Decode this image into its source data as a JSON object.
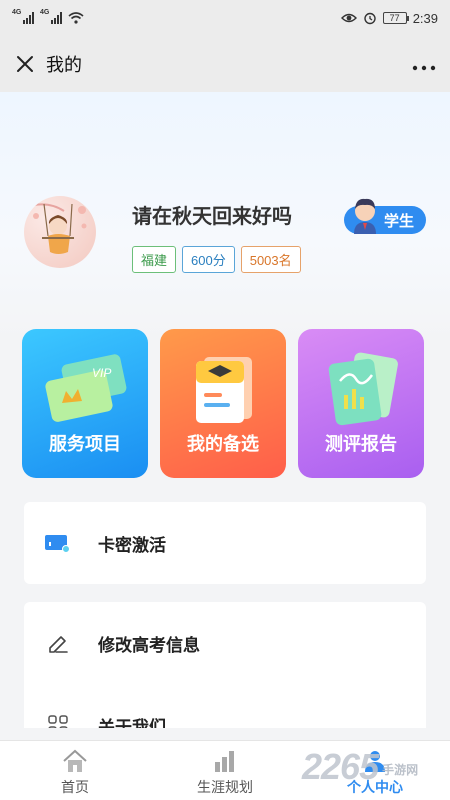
{
  "status_bar": {
    "signal_labels": [
      "4G",
      "4G"
    ],
    "battery": "77",
    "time": "2:39"
  },
  "nav": {
    "title": "我的"
  },
  "profile": {
    "name": "请在秋天回来好吗",
    "role": "学生",
    "tags": [
      "福建",
      "600分",
      "5003名"
    ]
  },
  "cards": [
    {
      "label": "服务项目",
      "art_text": "VIP"
    },
    {
      "label": "我的备选"
    },
    {
      "label": "测评报告"
    }
  ],
  "list": [
    {
      "label": "卡密激活",
      "icon": "card-icon"
    },
    {
      "label": "修改高考信息",
      "icon": "edit-icon"
    },
    {
      "label": "关于我们",
      "icon": "grid-icon"
    }
  ],
  "tabs": [
    {
      "label": "首页",
      "icon": "home-icon"
    },
    {
      "label": "生涯规划",
      "icon": "chart-icon"
    },
    {
      "label": "个人中心",
      "icon": "person-icon",
      "active": true
    }
  ],
  "watermark": {
    "number": "2265",
    "text": "手游网"
  },
  "colors": {
    "accent": "#2f8cf0",
    "tag_green": "#3a9a4a",
    "tag_blue": "#2a7fbf",
    "tag_orange": "#d9762a"
  }
}
